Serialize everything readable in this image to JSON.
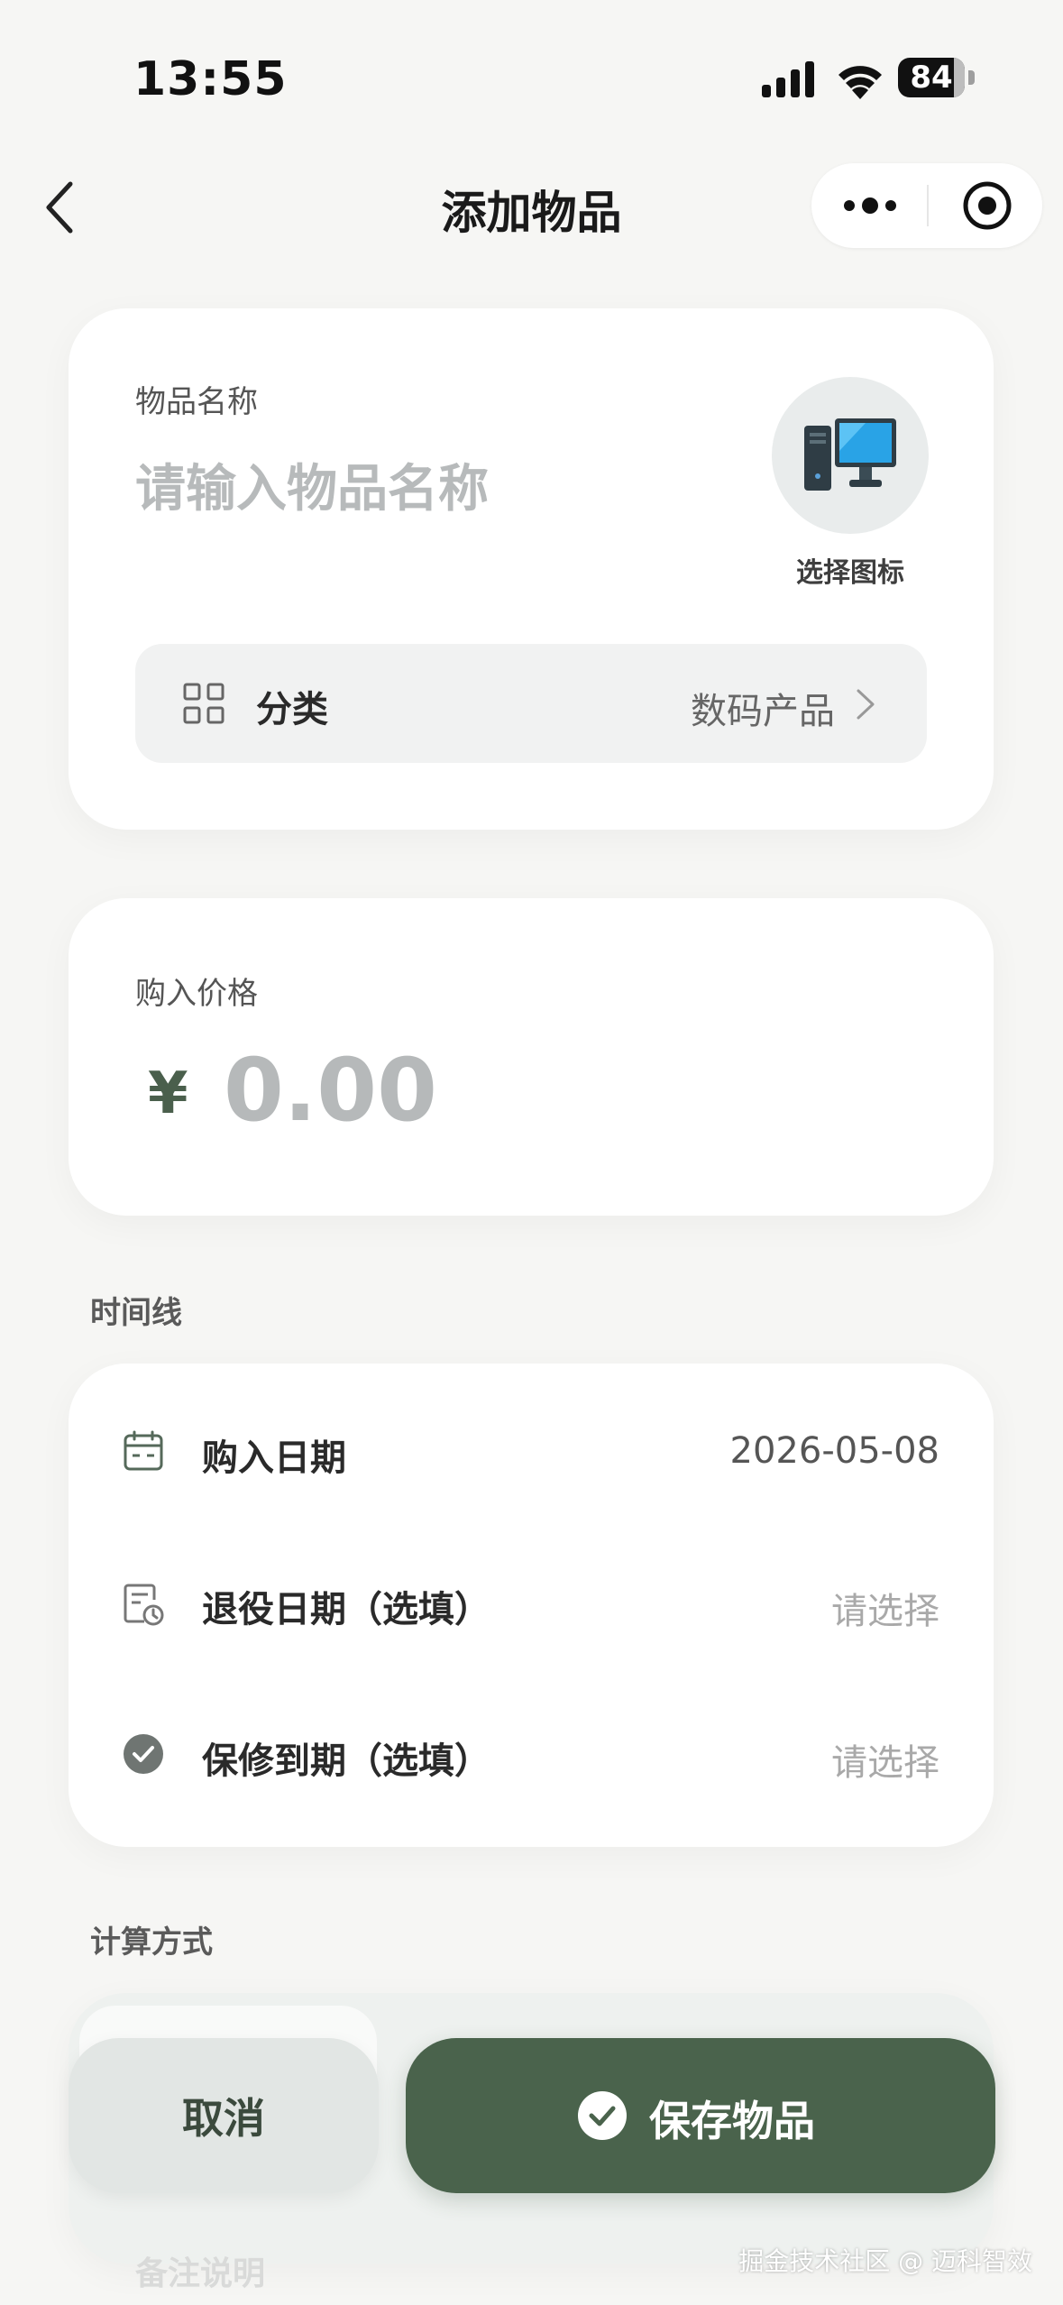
{
  "status_bar": {
    "time": "13:55",
    "battery": "84",
    "battery_level": 0.84
  },
  "nav": {
    "title": "添加物品",
    "icons": {
      "back": "chevron-left-icon",
      "more": "more-dots-icon",
      "close": "target-close-icon"
    }
  },
  "item_card": {
    "name_label": "物品名称",
    "name_placeholder": "请输入物品名称",
    "name_value": "",
    "icon_picker_label": "选择图标",
    "selected_icon": "desktop-computer-icon",
    "category_label": "分类",
    "category_value": "数码产品"
  },
  "price_card": {
    "label": "购入价格",
    "currency": "¥",
    "placeholder": "0.00",
    "value": ""
  },
  "timeline": {
    "section_title": "时间线",
    "rows": [
      {
        "label": "购入日期",
        "value": "2026-05-08",
        "icon": "calendar-icon"
      },
      {
        "label": "退役日期（选填）",
        "value": "请选择",
        "icon": "calendar-clock-icon"
      },
      {
        "label": "保修到期（选填）",
        "value": "请选择",
        "icon": "check-circle-icon"
      }
    ]
  },
  "calc": {
    "section_title": "计算方式"
  },
  "remarks": {
    "label": "备注说明"
  },
  "actions": {
    "cancel_label": "取消",
    "save_label": "保存物品"
  },
  "watermark": "掘金技术社区 @ 迈科智效",
  "colors": {
    "accent": "#4a634c",
    "background": "#f6f6f4",
    "card": "#ffffff",
    "placeholder": "#b7babb"
  }
}
